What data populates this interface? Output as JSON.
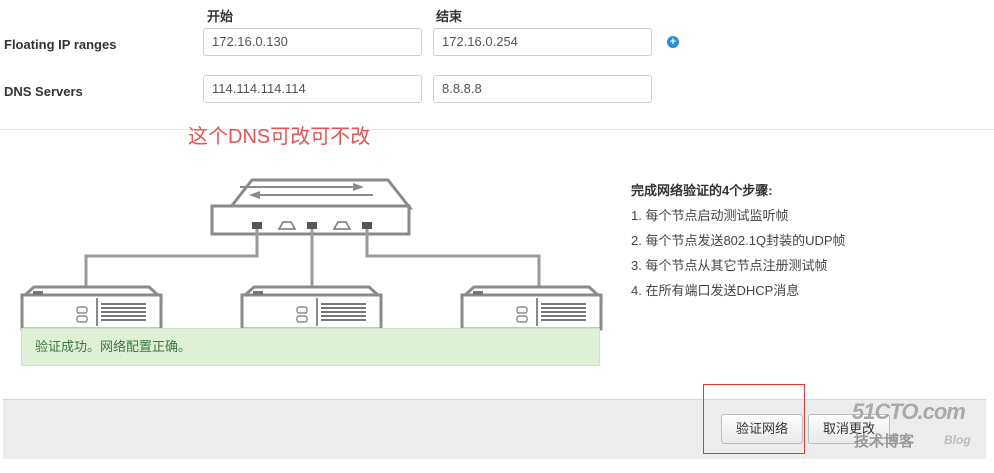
{
  "columns": {
    "start": "开始",
    "end": "结束"
  },
  "floating": {
    "label": "Floating IP ranges",
    "start_value": "172.16.0.130",
    "end_value": "172.16.0.254",
    "add_icon": "plus-circle-icon"
  },
  "dns": {
    "label": "DNS Servers",
    "server1": "114.114.114.114",
    "server2": "8.8.8.8"
  },
  "annotation": "这个DNS可改可不改",
  "steps": {
    "title": "完成网络验证的4个步骤:",
    "items": [
      "1. 每个节点启动测试监听帧",
      "2. 每个节点发送802.1Q封装的UDP帧",
      "3. 每个节点从其它节点注册测试帧",
      "4. 在所有端口发送DHCP消息"
    ]
  },
  "success_message": "验证成功。网络配置正确。",
  "buttons": {
    "verify": "验证网络",
    "cancel": "取消更改"
  },
  "watermark": {
    "line1": "51CTO.com",
    "line2": "技术博客",
    "line3": "Blog"
  },
  "colors": {
    "accent": "#2a8fd8",
    "success_bg": "#dff0d8",
    "success_text": "#3c763d",
    "annotation": "#e05555",
    "diagram_gray": "#8a8a8a"
  }
}
